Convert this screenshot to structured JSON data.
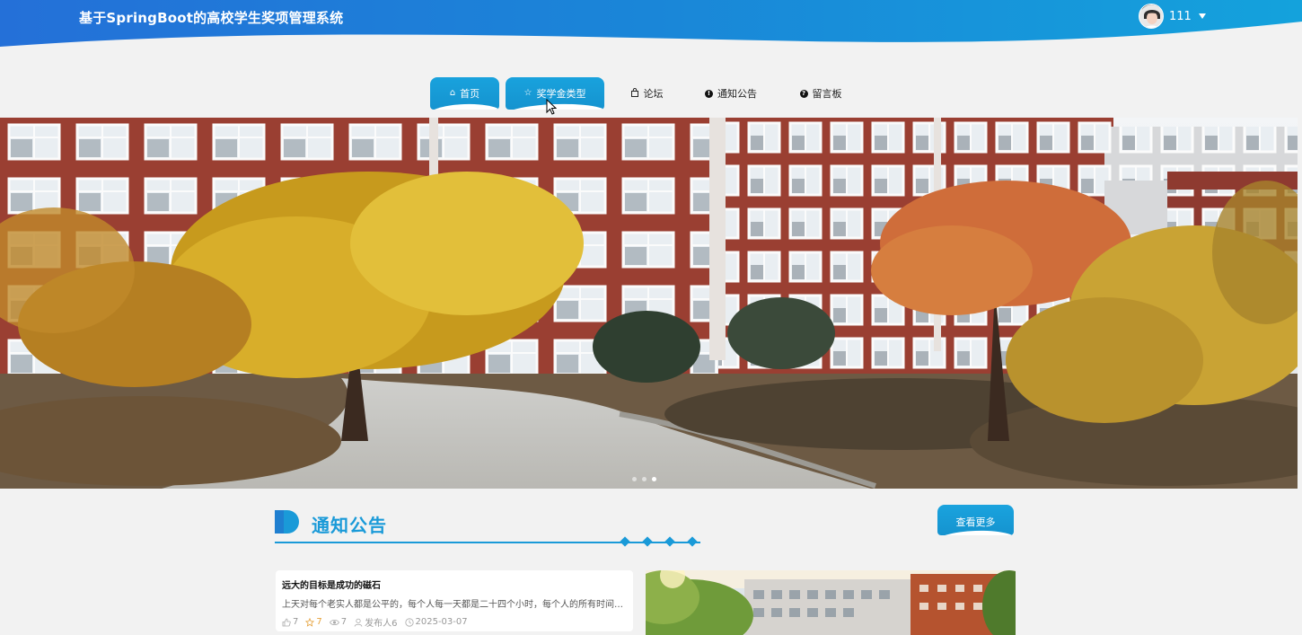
{
  "header": {
    "site_title": "基于SpringBoot的高校学生奖项管理系统",
    "username": "111"
  },
  "nav": {
    "items": [
      {
        "label": "首页",
        "icon": "home-icon"
      },
      {
        "label": "奖学金类型",
        "icon": "star-icon"
      },
      {
        "label": "论坛",
        "icon": "bag-icon"
      },
      {
        "label": "通知公告",
        "icon": "info-icon"
      },
      {
        "label": "留言板",
        "icon": "question-icon"
      }
    ]
  },
  "banner": {
    "slide_count": 3,
    "active_slide": 3
  },
  "notices": {
    "section_title": "通知公告",
    "more_label": "查看更多",
    "items": [
      {
        "title": "远大的目标是成功的磁石",
        "body": "上天对每个老实人都是公平的，每个人每一天都是二十四个小时，每个人的所有时间都是...",
        "likes": "7",
        "favorites": "7",
        "views": "7",
        "publisher": "发布人6",
        "date": "2025-03-07"
      }
    ]
  },
  "colors": {
    "primary": "#1a9ad8",
    "header_dark": "#1f6fd6",
    "gold": "#e6a23c"
  }
}
